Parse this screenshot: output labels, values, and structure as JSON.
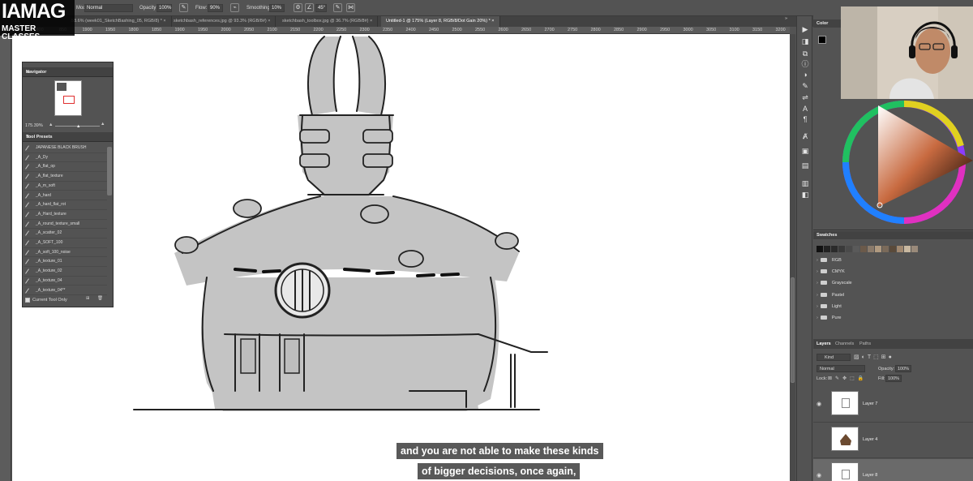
{
  "logo": {
    "line1": "IAMAG",
    "line2": "MASTER CLASSES"
  },
  "options_bar": {
    "mode_label": "Mode:",
    "mode_value": "Normal",
    "opacity_label": "Opacity:",
    "opacity_value": "100%",
    "flow_label": "Flow:",
    "flow_value": "90%",
    "smoothing_label": "Smoothing:",
    "smoothing_value": "10%",
    "angle_value": "45°"
  },
  "tabs": [
    {
      "label": "58.6% (week01_SketchBashing_05, RGB/8) *"
    },
    {
      "label": "sketchbash_references.jpg @ 93.3% (RGB/8#)"
    },
    {
      "label": "sketchbash_toolbox.jpg @ 36.7% (RGB/8#)"
    },
    {
      "label": "Untitled-1 @ 175% (Layer 8, RGB/8/Dot Gain 20%) *"
    }
  ],
  "ruler_ticks": [
    "750",
    "800",
    "850",
    "1900",
    "1950",
    "1800",
    "1850",
    "1900",
    "1950",
    "2000",
    "2050",
    "2100",
    "2150",
    "2200",
    "2250",
    "2300",
    "2350",
    "2400",
    "2450",
    "2500",
    "2550",
    "2600",
    "2650",
    "2700",
    "2750",
    "2800",
    "2850",
    "2900",
    "2950",
    "3000",
    "3050",
    "3100",
    "3150",
    "3200"
  ],
  "navigator": {
    "title": "Navigator",
    "zoom": "175.39%"
  },
  "tool_presets": {
    "title": "Tool Presets",
    "items": [
      "JAPANESE BLACK BRUSH",
      "_A_Dy",
      "_A_flat_op",
      "_A_flat_texture",
      "_A_m_soft",
      "_A_hard",
      "_A_hard_flat_rot",
      "_A_Hard_texture",
      "_A_round_texture_small",
      "_A_scatter_02",
      "_A_SOFT_100",
      "_A_soft_100_noise",
      "_A_texture_01",
      "_A_texture_02",
      "_A_texture_04",
      "_A_texture_04**"
    ],
    "current_tool_only": "Current Tool Only"
  },
  "color_panel": {
    "title": "Color"
  },
  "swatches": {
    "title": "Swatches",
    "colors": [
      "#111111",
      "#222222",
      "#2b2b2b",
      "#3a3a3a",
      "#4a4a4a",
      "#5a5a5a",
      "#6b5a4a",
      "#8a7a6a",
      "#b09a80",
      "#7a6a5a",
      "#5a4a3a",
      "#a08870",
      "#c8b8a0",
      "#9a8a7a"
    ],
    "folders": [
      "RGB",
      "CMYK",
      "Grayscale",
      "Pastel",
      "Light",
      "Pure"
    ]
  },
  "layers_panel": {
    "tabs": [
      "Layers",
      "Channels",
      "Paths"
    ],
    "kind_label": "Kind",
    "blend_mode": "Normal",
    "opacity_label": "Opacity:",
    "opacity_value": "100%",
    "lock_label": "Lock:",
    "fill_label": "Fill:",
    "fill_value": "100%",
    "layers": [
      {
        "name": "Layer 7",
        "visible": true
      },
      {
        "name": "Layer 4",
        "visible": false
      },
      {
        "name": "Layer 8",
        "visible": true
      }
    ]
  },
  "subtitles": [
    "and you are not able to make these kinds",
    "of bigger decisions, once again,"
  ]
}
